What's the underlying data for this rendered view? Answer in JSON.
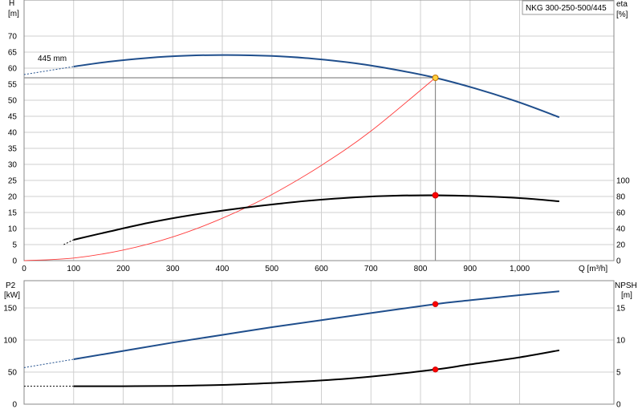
{
  "chart_data": [
    {
      "type": "line",
      "title": "NKG 300-250-500/445",
      "x": {
        "label": "Q [m³/h]",
        "range": [
          0,
          1150
        ],
        "ticks": [
          0,
          100,
          200,
          300,
          400,
          500,
          600,
          700,
          800,
          900,
          1000
        ],
        "tick_labels": [
          "0",
          "100",
          "200",
          "300",
          "400",
          "500",
          "600",
          "700",
          "800",
          "900",
          "1,000"
        ]
      },
      "y_left": {
        "label_line1": "H",
        "label_line2": "[m]",
        "range": [
          0,
          80
        ],
        "ticks": [
          0,
          5,
          10,
          15,
          20,
          25,
          30,
          35,
          40,
          45,
          50,
          55,
          60,
          65,
          70
        ]
      },
      "y_right": {
        "label_line1": "eta",
        "label_line2": "[%]",
        "range": [
          0,
          320
        ],
        "ticks": [
          0,
          20,
          40,
          60,
          80,
          100
        ]
      },
      "grid": true,
      "annotation": "445 mm",
      "series": [
        {
          "role": "head",
          "axis": "left",
          "color": "#1f4e8c",
          "points": [
            [
              100,
              60.5
            ],
            [
              170,
              62
            ],
            [
              250,
              63.2
            ],
            [
              330,
              63.9
            ],
            [
              410,
              64.1
            ],
            [
              500,
              63.8
            ],
            [
              580,
              63
            ],
            [
              670,
              61.5
            ],
            [
              750,
              59.5
            ],
            [
              830,
              57
            ],
            [
              910,
              53.7
            ],
            [
              1000,
              49.3
            ],
            [
              1080,
              44.7
            ]
          ],
          "extension_points": [
            [
              0,
              58
            ],
            [
              100,
              60.5
            ]
          ]
        },
        {
          "role": "system",
          "axis": "left",
          "color": "#ff3b3b",
          "points": [
            [
              0,
              0
            ],
            [
              100,
              0.8
            ],
            [
              200,
              3.3
            ],
            [
              300,
              7.4
            ],
            [
              400,
              13.2
            ],
            [
              500,
              20.6
            ],
            [
              600,
              29.7
            ],
            [
              700,
              40.4
            ],
            [
              830,
              57
            ]
          ]
        },
        {
          "role": "efficiency",
          "axis": "right",
          "color": "#000000",
          "points": [
            [
              100,
              26
            ],
            [
              170,
              36
            ],
            [
              250,
              47
            ],
            [
              330,
              56
            ],
            [
              420,
              64
            ],
            [
              500,
              70
            ],
            [
              580,
              75
            ],
            [
              670,
              79
            ],
            [
              750,
              81
            ],
            [
              830,
              81.5
            ],
            [
              910,
              80.5
            ],
            [
              1000,
              78
            ],
            [
              1080,
              74
            ]
          ],
          "extension_points": [
            [
              80,
              20
            ],
            [
              100,
              26
            ]
          ]
        }
      ],
      "operating_points": [
        {
          "x": 830,
          "y": 57,
          "axis": "left",
          "fill": "#ffd23f",
          "stroke": "#c07000"
        },
        {
          "x": 830,
          "y": 81.5,
          "axis": "right",
          "fill": "#ff0000",
          "stroke": "#cc0000"
        }
      ],
      "guide": {
        "x": 830,
        "y": 57
      }
    },
    {
      "type": "line",
      "x": {
        "range": [
          0,
          1150
        ],
        "ticks": [
          100,
          200,
          300,
          400,
          500,
          600,
          700,
          800,
          900,
          1000
        ]
      },
      "y_left": {
        "label_line1": "P2",
        "label_line2": "[kW]",
        "range": [
          0,
          200
        ],
        "ticks": [
          0,
          50,
          100,
          150
        ]
      },
      "y_right": {
        "label_line1": "NPSH",
        "label_line2": "[m]",
        "range": [
          0,
          20
        ],
        "ticks": [
          0,
          5,
          10,
          15
        ]
      },
      "grid": true,
      "series": [
        {
          "role": "power",
          "axis": "left",
          "color": "#1f4e8c",
          "points": [
            [
              100,
              70
            ],
            [
              200,
              83
            ],
            [
              300,
              96
            ],
            [
              400,
              108
            ],
            [
              500,
              120
            ],
            [
              600,
              131
            ],
            [
              700,
              142
            ],
            [
              830,
              156
            ],
            [
              900,
              162
            ],
            [
              1000,
              170
            ],
            [
              1080,
              176
            ]
          ],
          "extension_points": [
            [
              0,
              57
            ],
            [
              100,
              70
            ]
          ]
        },
        {
          "role": "npsh",
          "axis": "right",
          "color": "#000000",
          "points": [
            [
              100,
              2.8
            ],
            [
              200,
              2.8
            ],
            [
              300,
              2.85
            ],
            [
              400,
              3
            ],
            [
              500,
              3.3
            ],
            [
              600,
              3.7
            ],
            [
              700,
              4.3
            ],
            [
              830,
              5.4
            ],
            [
              900,
              6.2
            ],
            [
              1000,
              7.3
            ],
            [
              1080,
              8.4
            ]
          ],
          "extension_points": [
            [
              0,
              2.8
            ],
            [
              100,
              2.8
            ]
          ]
        }
      ],
      "operating_points": [
        {
          "x": 830,
          "y": 156,
          "axis": "left",
          "fill": "#ff0000",
          "stroke": "#cc0000"
        },
        {
          "x": 830,
          "y": 5.4,
          "axis": "right",
          "fill": "#ff0000",
          "stroke": "#cc0000"
        }
      ]
    }
  ]
}
